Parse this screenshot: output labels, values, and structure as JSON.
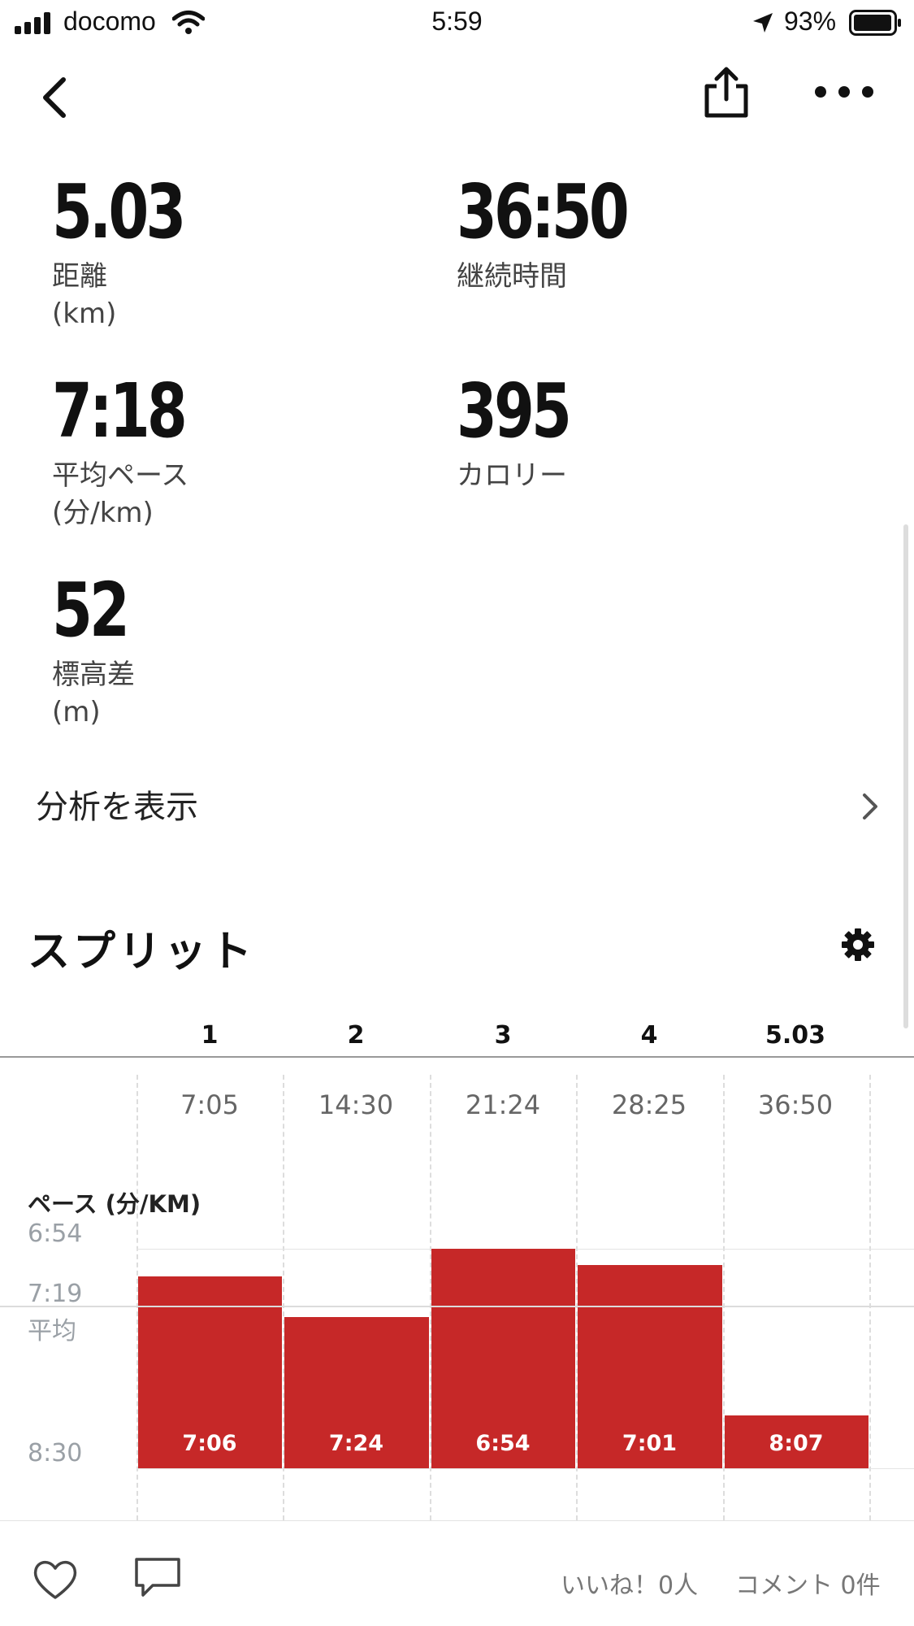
{
  "status_bar": {
    "carrier": "docomo",
    "time": "5:59",
    "battery": "93%"
  },
  "nav": {
    "back_icon": "chevron-left-icon",
    "share_icon": "share-icon",
    "more_icon": "more-horizontal-icon"
  },
  "stats": [
    {
      "value": "5.03",
      "label": "距離",
      "unit": "(km)"
    },
    {
      "value": "36:50",
      "label": "継続時間",
      "unit": ""
    },
    {
      "value": "7:18",
      "label": "平均ペース",
      "unit": "(分/km)"
    },
    {
      "value": "395",
      "label": "カロリー",
      "unit": ""
    },
    {
      "value": "52",
      "label": "標高差",
      "unit": "(m)"
    }
  ],
  "analysis_link": "分析を表示",
  "splits_title": "スプリット",
  "splits": {
    "headers": [
      "1",
      "2",
      "3",
      "4",
      "5.03"
    ],
    "cumulative": [
      "7:05",
      "14:30",
      "21:24",
      "28:25",
      "36:50"
    ],
    "pace_title": "ペース (分/KM)",
    "y_labels": {
      "top": "6:54",
      "avg_value": "7:19",
      "avg_label": "平均",
      "bottom": "8:30"
    }
  },
  "chart_data": {
    "type": "bar",
    "categories": [
      "1",
      "2",
      "3",
      "4",
      "5.03"
    ],
    "values": [
      426,
      444,
      414,
      421,
      487
    ],
    "value_labels": [
      "7:06",
      "7:24",
      "6:54",
      "7:01",
      "8:07"
    ],
    "ylabel": "ペース (分/KM)",
    "ylim": [
      414,
      510
    ],
    "average": 439,
    "average_label": "平均",
    "colors": {
      "bar": "#c62828"
    }
  },
  "footer": {
    "likes": "いいね！0人",
    "comments": "コメント 0件"
  }
}
